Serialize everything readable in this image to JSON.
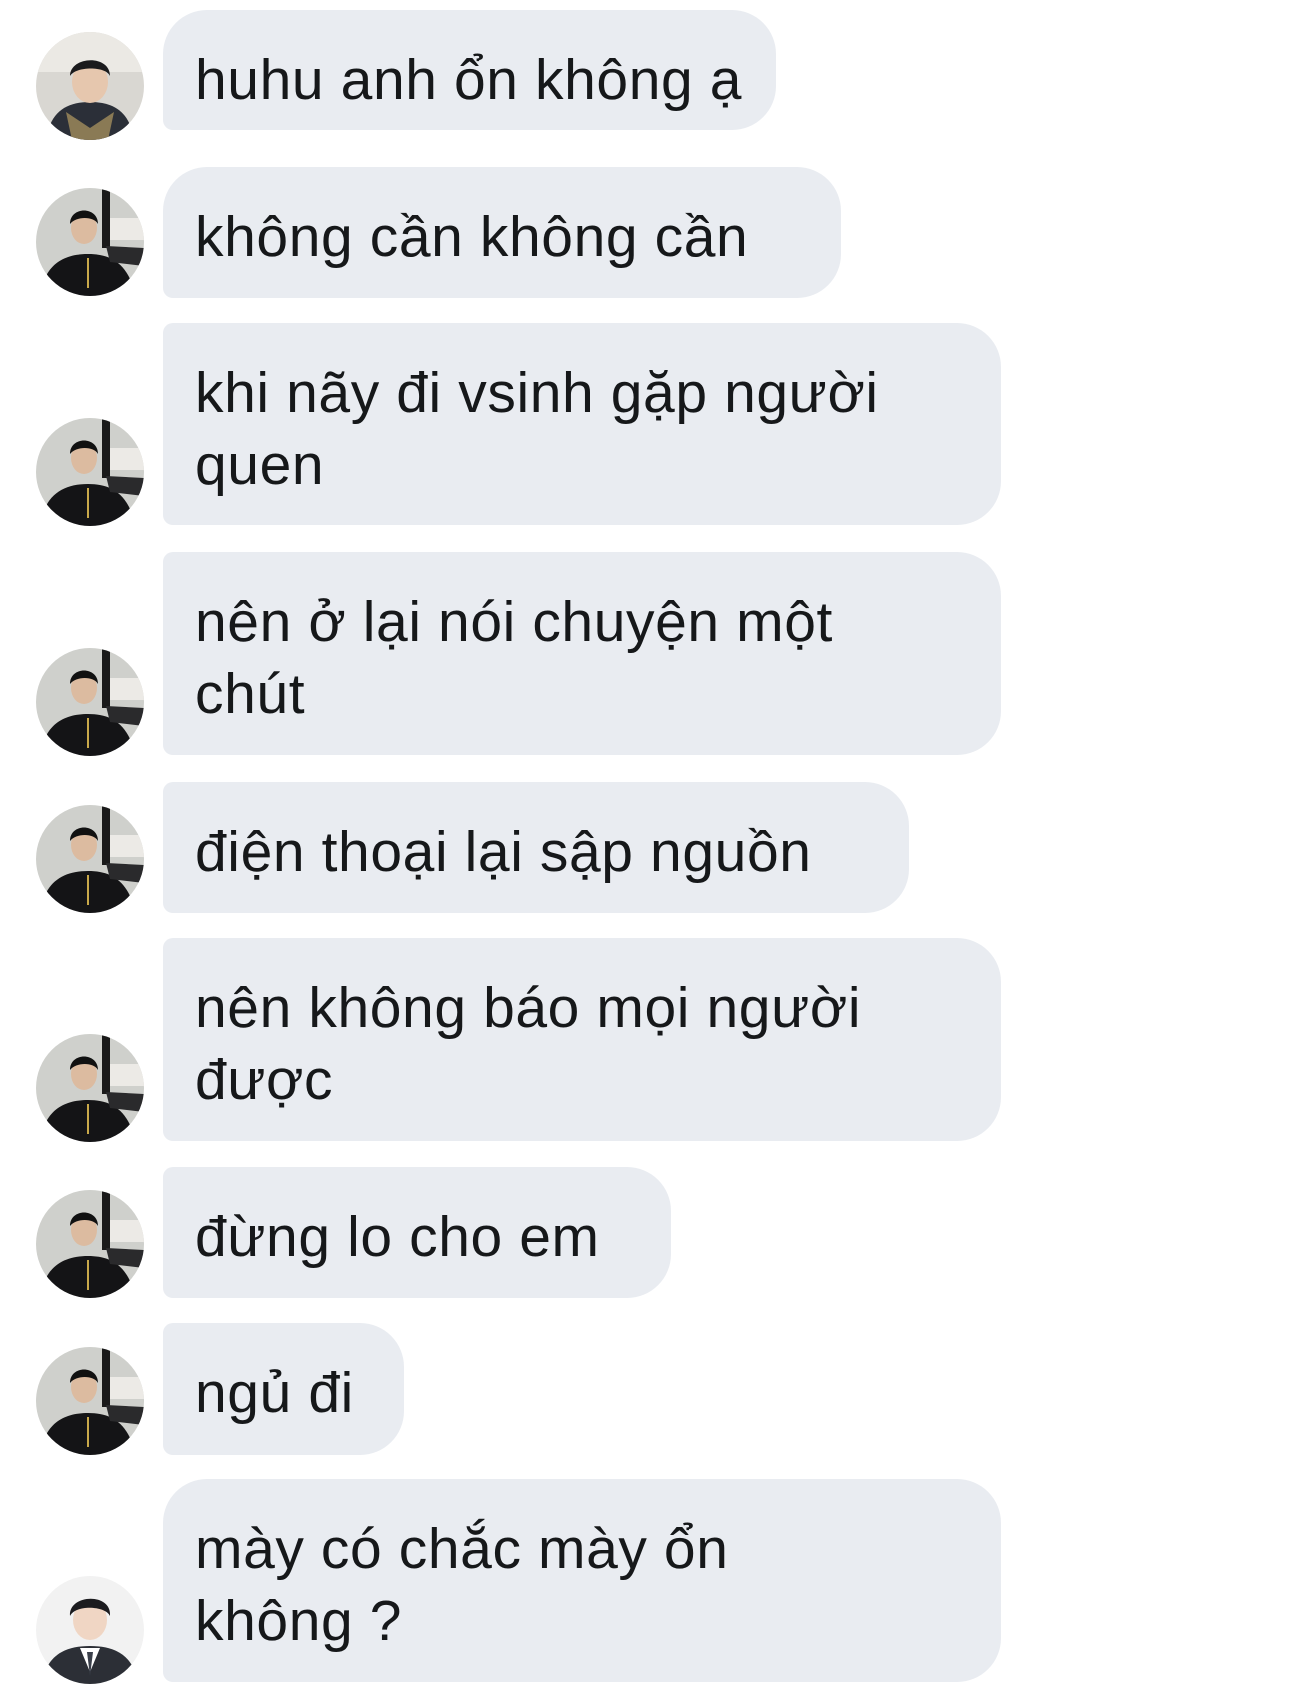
{
  "messages": [
    {
      "sender": "user-a",
      "avatar": "avatar-hoodie-photo",
      "text": "huhu anh ổn không ạ"
    },
    {
      "sender": "user-b",
      "avatar": "avatar-black-jacket-photo",
      "text": "không cần không cần"
    },
    {
      "sender": "user-b",
      "avatar": "avatar-black-jacket-photo",
      "text": "khi nãy đi vsinh gặp người\nquen"
    },
    {
      "sender": "user-b",
      "avatar": "avatar-black-jacket-photo",
      "text": "nên ở lại nói chuyện một\nchút"
    },
    {
      "sender": "user-b",
      "avatar": "avatar-black-jacket-photo",
      "text": "điện thoại lại sập nguồn"
    },
    {
      "sender": "user-b",
      "avatar": "avatar-black-jacket-photo",
      "text": "nên không báo mọi người\nđược"
    },
    {
      "sender": "user-b",
      "avatar": "avatar-black-jacket-photo",
      "text": "đừng lo cho em"
    },
    {
      "sender": "user-b",
      "avatar": "avatar-black-jacket-photo",
      "text": "ngủ đi"
    },
    {
      "sender": "user-c",
      "avatar": "avatar-suit-photo",
      "text": "mày có chắc mày ổn\nkhông ?"
    }
  ],
  "colors": {
    "bubble_bg": "#e9ecf1",
    "text": "#16181a",
    "page_bg": "#ffffff"
  }
}
